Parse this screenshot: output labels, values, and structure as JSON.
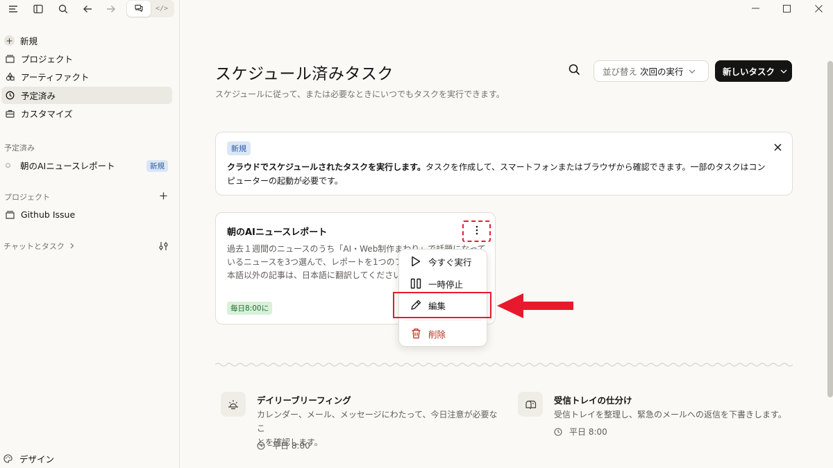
{
  "sidebar": {
    "top_icons": [
      "menu-icon",
      "sidebar-toggle-icon",
      "search-icon",
      "arrow-left-icon",
      "arrow-right-icon"
    ],
    "toggle": {
      "chat_icon": "chat-icon",
      "code_glyph": "</>"
    },
    "nav": [
      {
        "label": "新規",
        "icon": "plus-icon"
      },
      {
        "label": "プロジェクト",
        "icon": "folder-icon"
      },
      {
        "label": "アーティファクト",
        "icon": "artifact-icon"
      },
      {
        "label": "予定済み",
        "icon": "clock-icon"
      },
      {
        "label": "カスタマイズ",
        "icon": "briefcase-icon"
      }
    ],
    "scheduled_label": "予定済み",
    "scheduled_items": [
      {
        "label": "朝のAIニュースレポート",
        "badge": "新規"
      }
    ],
    "projects_label": "プロジェクト",
    "projects": [
      {
        "label": "Github Issue"
      }
    ],
    "chats_label": "チャットとタスク",
    "footer_label": "デザイン"
  },
  "main": {
    "title": "スケジュール済みタスク",
    "subtitle": "スケジュールに従って、または必要なときにいつでもタスクを実行できます。",
    "sort_prefix": "並び替え",
    "sort_value": "次回の実行",
    "new_task_label": "新しいタスク",
    "banner": {
      "badge": "新規",
      "text_bold": "クラウドでスケジュールされたタスクを実行します。",
      "text_rest": "タスクを作成して、スマートフォンまたはブラウザから確認できます。一部のタスクはコンピューターの起動が必要です。"
    },
    "task_card": {
      "title": "朝のAIニュースレポート",
      "description": "過去１週間のニュースのうち「AI・Web制作まわり」で話題になっているニュースを3つ選んで、レポートを1つのファイルにまとめて。日本語以外の記事は、日本語に翻訳してください。",
      "schedule": "毎日8:00に"
    },
    "menu": {
      "items": [
        {
          "label": "今すぐ実行",
          "icon": "play-icon"
        },
        {
          "label": "一時停止",
          "icon": "pause-icon"
        },
        {
          "label": "編集",
          "icon": "pencil-icon"
        },
        {
          "label": "削除",
          "icon": "trash-icon"
        }
      ]
    },
    "suggestions": [
      {
        "title": "デイリーブリーフィング",
        "description_line1": "カレンダー、メール、メッセージにわたって、今日注意が必要なこ",
        "description_line2": "とを確認します。",
        "time": "平日 8:00",
        "icon": "sunrise-icon"
      },
      {
        "title": "受信トレイの仕分け",
        "description_line1": "受信トレイを整理し、緊急のメールへの返信を下書きします。",
        "description_line2": "",
        "time": "平日 8:00",
        "icon": "mailbox-icon"
      }
    ]
  },
  "colors": {
    "accent_red": "#e8192c",
    "badge_blue_bg": "#dbe6f7",
    "badge_green_bg": "#d9f0d9",
    "primary_dark": "#141413"
  }
}
